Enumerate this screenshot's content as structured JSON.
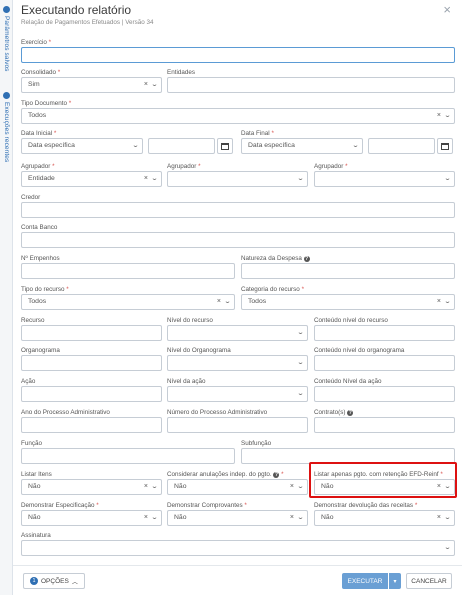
{
  "side_tabs": [
    "Parâmetros salvos",
    "Execuções recentes"
  ],
  "header": {
    "title": "Executando relatório",
    "subtitle": "Relação de Pagamentos Efetuados | Versão 34",
    "close_symbol": "×"
  },
  "fields": {
    "exercicio": {
      "label": "Exercício",
      "value": ""
    },
    "consolidado": {
      "label": "Consolidado",
      "value": "Sim"
    },
    "entidades": {
      "label": "Entidades",
      "value": ""
    },
    "tipo_documento": {
      "label": "Tipo Documento",
      "value": "Todos"
    },
    "data_inicial": {
      "label": "Data Inicial",
      "value": "Data específica",
      "date": ""
    },
    "data_final": {
      "label": "Data Final",
      "value": "Data específica",
      "date": ""
    },
    "agrupador1": {
      "label": "Agrupador",
      "value": "Entidade"
    },
    "agrupador2": {
      "label": "Agrupador",
      "value": ""
    },
    "agrupador3": {
      "label": "Agrupador",
      "value": ""
    },
    "credor": {
      "label": "Credor",
      "value": ""
    },
    "conta_banco": {
      "label": "Conta Banco",
      "value": ""
    },
    "n_empenhos": {
      "label": "Nº Empenhos",
      "value": ""
    },
    "natureza_despesa": {
      "label": "Natureza da Despesa",
      "value": ""
    },
    "tipo_recurso": {
      "label": "Tipo do recurso",
      "value": "Todos"
    },
    "categoria_recurso": {
      "label": "Categoria do recurso",
      "value": "Todos"
    },
    "recurso": {
      "label": "Recurso",
      "value": ""
    },
    "nivel_recurso": {
      "label": "Nível do recurso",
      "value": ""
    },
    "conteudo_nivel_recurso": {
      "label": "Conteúdo nível do recurso",
      "value": ""
    },
    "organograma": {
      "label": "Organograma",
      "value": ""
    },
    "nivel_organograma": {
      "label": "Nível do Organograma",
      "value": ""
    },
    "conteudo_nivel_organograma": {
      "label": "Conteúdo nível do organograma",
      "value": ""
    },
    "acao": {
      "label": "Ação",
      "value": ""
    },
    "nivel_acao": {
      "label": "Nível da ação",
      "value": ""
    },
    "conteudo_nivel_acao": {
      "label": "Conteúdo Nível da ação",
      "value": ""
    },
    "ano_processo": {
      "label": "Ano do Processo Administrativo",
      "value": ""
    },
    "numero_processo": {
      "label": "Número do Processo Administrativo",
      "value": ""
    },
    "contratos": {
      "label": "Contrato(s)",
      "value": ""
    },
    "funcao": {
      "label": "Função",
      "value": ""
    },
    "subfuncao": {
      "label": "Subfunção",
      "value": ""
    },
    "listar_itens": {
      "label": "Listar Itens",
      "value": "Não"
    },
    "considerar_anulacoes": {
      "label": "Considerar anulações indep. do pgto.",
      "value": "Não"
    },
    "listar_efd_reinf": {
      "label": "Listar apenas pgto. com retenção EFD-Reinf",
      "value": "Não"
    },
    "demonstrar_especificacao": {
      "label": "Demonstrar Especificação",
      "value": "Não"
    },
    "demonstrar_comprovantes": {
      "label": "Demonstrar Comprovantes",
      "value": "Não"
    },
    "demonstrar_devolucao": {
      "label": "Demonstrar devolução das receitas",
      "value": "Não"
    },
    "assinatura": {
      "label": "Assinatura",
      "value": ""
    }
  },
  "footer": {
    "options_count": "1",
    "options_label": "OPÇÕES",
    "execute_label": "EXECUTAR",
    "cancel_label": "CANCELAR"
  },
  "colors": {
    "accent": "#2f6fb3",
    "execute_button": "#6a9fd4",
    "required": "#d9534f",
    "highlight": "#dd1111"
  },
  "icons": {
    "clear": "×",
    "dropdown": "chevron-down-icon",
    "calendar": "calendar-icon",
    "info": "info-icon",
    "caret_up": "chevron-up-icon"
  }
}
